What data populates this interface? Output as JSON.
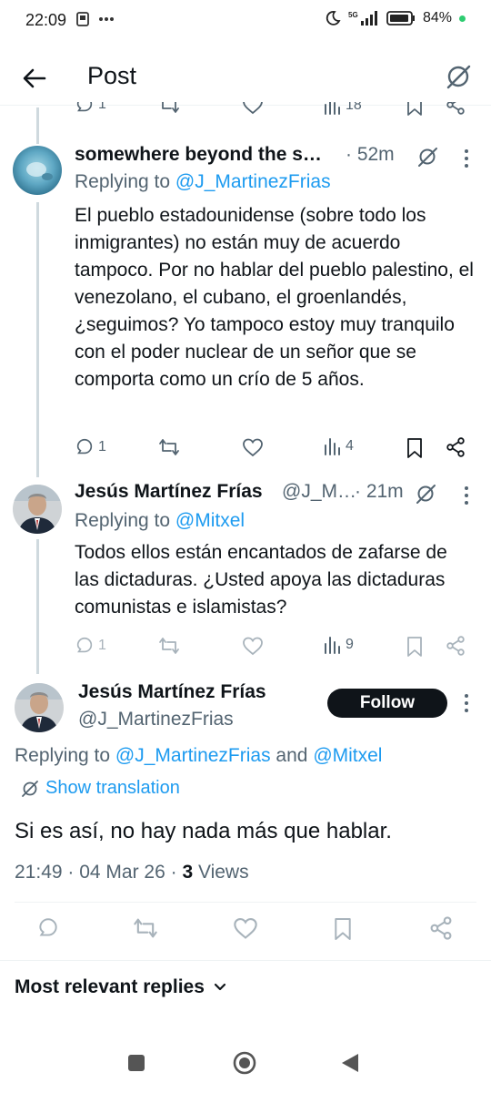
{
  "status_bar": {
    "time": "22:09",
    "battery": "84%",
    "icons": [
      "screen-record-icon",
      "more-icon",
      "moon-icon",
      "signal-5g-icon",
      "battery-icon",
      "notification-dot-icon"
    ]
  },
  "header": {
    "title": "Post",
    "back_icon": "arrow-left-icon",
    "grok_icon": "grok-icon"
  },
  "prev_actions": {
    "replies": "1",
    "views": "18"
  },
  "tweet1": {
    "name": "somewhere beyond the s…",
    "time": "· 52m",
    "replying_prefix": "Replying to ",
    "replying_to": "@J_MartinezFrias",
    "body": "El pueblo estadounidense (sobre todo los inmigrantes) no están muy de acuerdo tampoco. Por no hablar del pueblo palestino, el venezolano, el cubano, el groenlandés, ¿seguimos? Yo tampoco estoy muy tranquilo con el poder nuclear de un señor que se comporta como un crío de 5 años.",
    "replies": "1",
    "views": "4"
  },
  "tweet2": {
    "name": "Jesús Martínez Frías",
    "handle": "@J_M…",
    "time": "· 21m",
    "replying_prefix": "Replying to ",
    "replying_to": "@Mitxel",
    "body": "Todos ellos están encantados de zafarse de las dictaduras. ¿Usted apoya las dictaduras comunistas e islamistas?",
    "replies": "1",
    "views": "9"
  },
  "main_tweet": {
    "name": "Jesús Martínez Frías",
    "handle": "@J_MartinezFrias",
    "follow_label": "Follow",
    "replying_prefix": "Replying to ",
    "replying_to_1": "@J_MartinezFrias",
    "replying_and": " and ",
    "replying_to_2": "@Mitxel",
    "show_translation": "Show translation",
    "body": "Si es así, no hay nada más que hablar.",
    "timestamp": "21:49 · 04 Mar 26 · ",
    "views_count": "3",
    "views_label": " Views"
  },
  "replies_sort": {
    "label": "Most relevant replies"
  },
  "colors": {
    "accent": "#1d9bf0",
    "text": "#0f1419",
    "secondary": "#536471",
    "divider": "#eff3f4"
  }
}
